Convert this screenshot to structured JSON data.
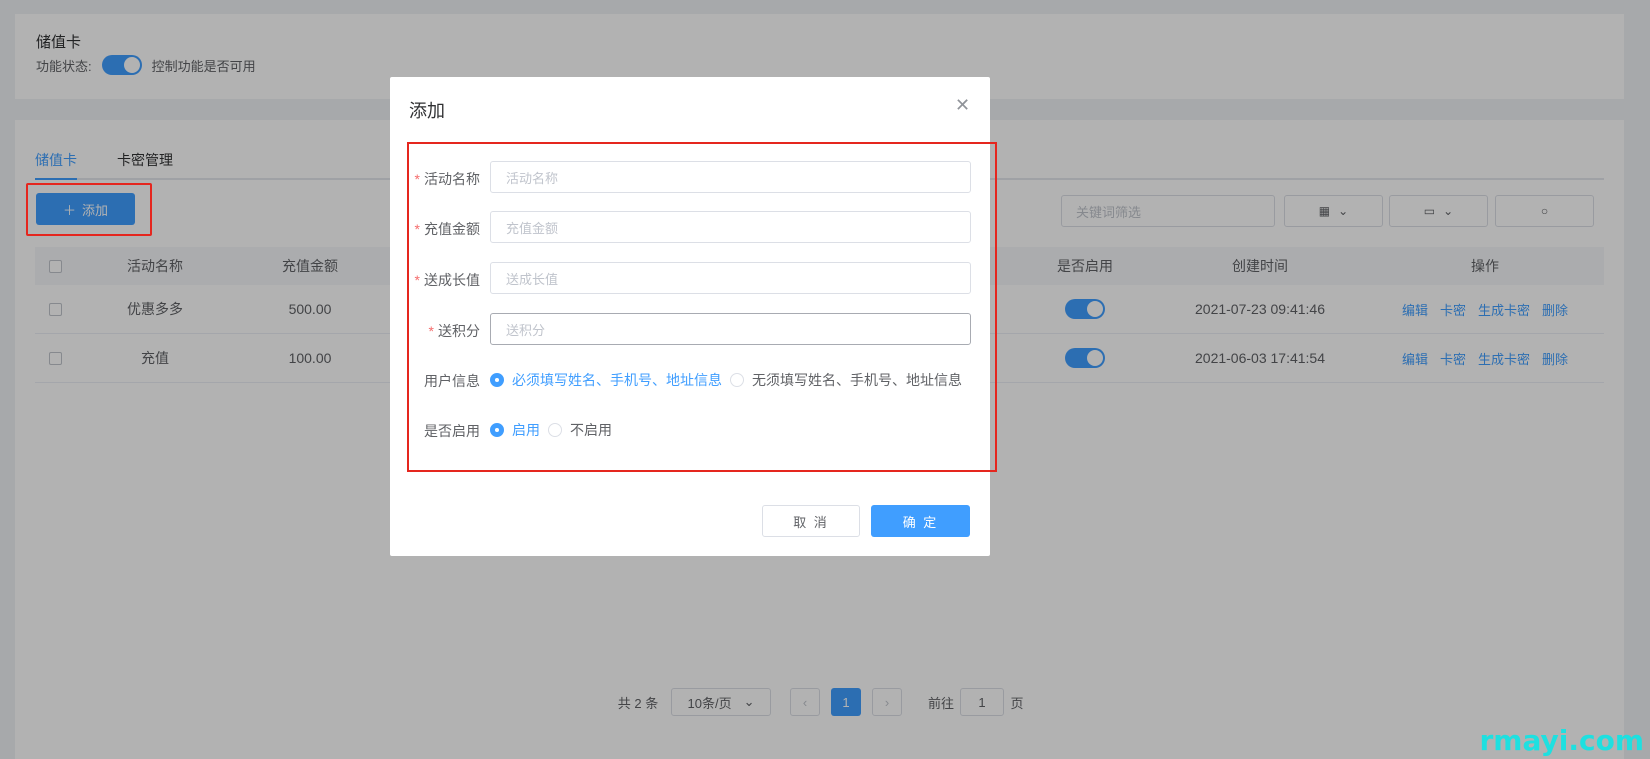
{
  "top": {
    "title": "储值卡",
    "status_label": "功能状态:",
    "status_desc": "控制功能是否可用"
  },
  "tabs": [
    {
      "label": "储值卡",
      "active": true
    },
    {
      "label": "卡密管理",
      "active": false
    }
  ],
  "toolbar": {
    "add_label": "添加",
    "search_placeholder": "关键词筛选"
  },
  "table": {
    "headers": [
      "活动名称",
      "充值金额",
      "是否启用",
      "创建时间",
      "操作"
    ],
    "rows": [
      {
        "name": "优惠多多",
        "amount": "500.00",
        "enabled": true,
        "created": "2021-07-23 09:41:46"
      },
      {
        "name": "充值",
        "amount": "100.00",
        "enabled": true,
        "created": "2021-06-03 17:41:54"
      }
    ],
    "actions": [
      "编辑",
      "卡密",
      "生成卡密",
      "删除"
    ]
  },
  "pagination": {
    "total": "共 2 条",
    "page_size": "10条/页",
    "current_page": "1",
    "goto_label": "前往",
    "goto_value": "1",
    "page_suffix": "页"
  },
  "dialog": {
    "title": "添加",
    "fields": [
      {
        "label": "活动名称",
        "placeholder": "活动名称"
      },
      {
        "label": "充值金额",
        "placeholder": "充值金额"
      },
      {
        "label": "送成长值",
        "placeholder": "送成长值"
      },
      {
        "label": "送积分",
        "placeholder": "送积分"
      }
    ],
    "user_info": {
      "label": "用户信息",
      "options": [
        "必须填写姓名、手机号、地址信息",
        "无须填写姓名、手机号、地址信息"
      ],
      "selected": 0
    },
    "enable": {
      "label": "是否启用",
      "options": [
        "启用",
        "不启用"
      ],
      "selected": 0
    },
    "cancel_label": "取 消",
    "ok_label": "确 定"
  },
  "watermark": "rmayi.com",
  "colors": {
    "primary": "#409eff",
    "highlight": "#e5261e",
    "required": "#f56c6c"
  }
}
